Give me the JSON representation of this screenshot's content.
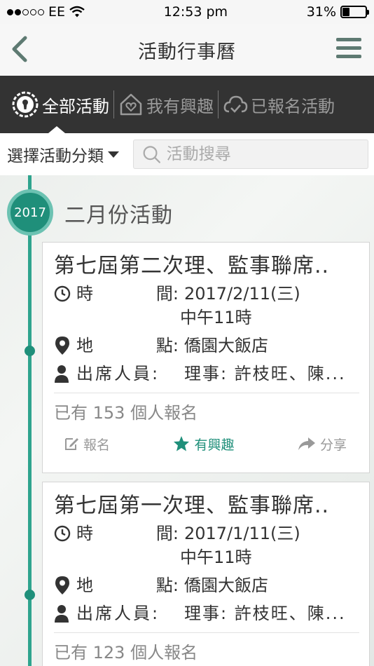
{
  "status_bar": {
    "carrier": "EE",
    "time": "12:53 pm",
    "battery": "31%",
    "battery_level": 0.31
  },
  "nav": {
    "title": "活動行事曆",
    "back_icon": "chevron-left-icon",
    "menu_icon": "hamburger-menu-icon"
  },
  "tabs": [
    {
      "label": "全部活動",
      "icon": "keyhole-icon",
      "active": true
    },
    {
      "label": "我有興趣",
      "icon": "house-heart-icon",
      "active": false
    },
    {
      "label": "已報名活動",
      "icon": "cloud-check-icon",
      "active": false
    }
  ],
  "filter": {
    "category_label": "選擇活動分類",
    "search_placeholder": "活動搜尋"
  },
  "timeline": {
    "year": "2017",
    "month_title": "二月份活動"
  },
  "events": [
    {
      "title": "第七屆第二次理、監事聯席..",
      "time_label_1": "時",
      "time_label_2": "間:",
      "time_value": "2017/2/11(三)",
      "time_value_2": "中午11時",
      "place_label_1": "地",
      "place_label_2": "點:",
      "place_value": "僑園大飯店",
      "people_label": "出席人員:",
      "people_value": "理事: 許枝旺、陳...",
      "signup_text": "已有 153 個人報名",
      "actions": {
        "signup": "報名",
        "interest": "有興趣",
        "share": "分享"
      }
    },
    {
      "title": "第七屆第一次理、監事聯席..",
      "time_label_1": "時",
      "time_label_2": "間:",
      "time_value": "2017/1/11(三)",
      "time_value_2": "中午11時",
      "place_label_1": "地",
      "place_label_2": "點:",
      "place_value": "僑園大飯店",
      "people_label": "出席人員:",
      "people_value": "理事: 許枝旺、陳...",
      "signup_text": "已有 123 個人報名"
    }
  ],
  "colors": {
    "accent": "#1f8f7a",
    "tab_bar": "#333333",
    "menu_icon": "#5e7a72"
  }
}
